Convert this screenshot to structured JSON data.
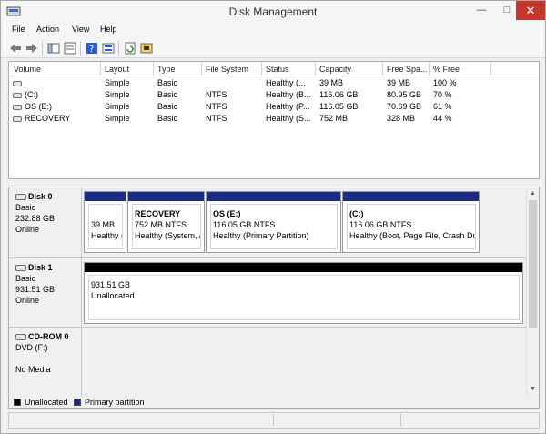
{
  "window": {
    "title": "Disk Management",
    "minimize_glyph": "—",
    "maximize_glyph": "□",
    "close_glyph": "✕"
  },
  "menu": [
    "File",
    "Action",
    "View",
    "Help"
  ],
  "toolbar_icons": [
    "back-icon",
    "forward-icon",
    "console-tree-icon",
    "properties-icon",
    "help-icon",
    "help-topic-icon",
    "refresh-icon",
    "rescan-icon"
  ],
  "volume_list": {
    "columns": [
      "Volume",
      "Layout",
      "Type",
      "File System",
      "Status",
      "Capacity",
      "Free Spa...",
      "% Free"
    ],
    "rows": [
      {
        "volume": "",
        "layout": "Simple",
        "type": "Basic",
        "fs": "",
        "status": "Healthy (...",
        "capacity": "39 MB",
        "free": "39 MB",
        "pct": "100 %"
      },
      {
        "volume": "(C:)",
        "layout": "Simple",
        "type": "Basic",
        "fs": "NTFS",
        "status": "Healthy (B...",
        "capacity": "116.06 GB",
        "free": "80.95 GB",
        "pct": "70 %"
      },
      {
        "volume": "OS (E:)",
        "layout": "Simple",
        "type": "Basic",
        "fs": "NTFS",
        "status": "Healthy (P...",
        "capacity": "116.05 GB",
        "free": "70.69 GB",
        "pct": "61 %"
      },
      {
        "volume": "RECOVERY",
        "layout": "Simple",
        "type": "Basic",
        "fs": "NTFS",
        "status": "Healthy (S...",
        "capacity": "752 MB",
        "free": "328 MB",
        "pct": "44 %"
      }
    ]
  },
  "disks": {
    "disk0": {
      "name": "Disk 0",
      "kind": "Basic",
      "size": "232.88 GB",
      "state": "Online",
      "partitions": [
        {
          "name": "",
          "line1": "39 MB",
          "line2": "Healthy (",
          "color": "#1c2a88"
        },
        {
          "name": "RECOVERY",
          "line1": "752 MB NTFS",
          "line2": "Healthy (System, A",
          "color": "#1c2a88"
        },
        {
          "name": "OS  (E:)",
          "line1": "116.05 GB NTFS",
          "line2": "Healthy (Primary Partition)",
          "color": "#1c2a88"
        },
        {
          "name": "(C:)",
          "line1": "116.06 GB NTFS",
          "line2": "Healthy (Boot, Page File, Crash Du",
          "color": "#1c2a88"
        }
      ]
    },
    "disk1": {
      "name": "Disk 1",
      "kind": "Basic",
      "size": "931.51 GB",
      "state": "Online",
      "partitions": [
        {
          "name": "",
          "line1": "931.51 GB",
          "line2": "Unallocated",
          "color": "#000000"
        }
      ]
    },
    "cdrom0": {
      "name": "CD-ROM 0",
      "kind": "DVD (F:)",
      "size": "",
      "state": "No Media"
    }
  },
  "legend": [
    {
      "label": "Unallocated",
      "color": "#000000"
    },
    {
      "label": "Primary partition",
      "color": "#1c2a88"
    }
  ]
}
